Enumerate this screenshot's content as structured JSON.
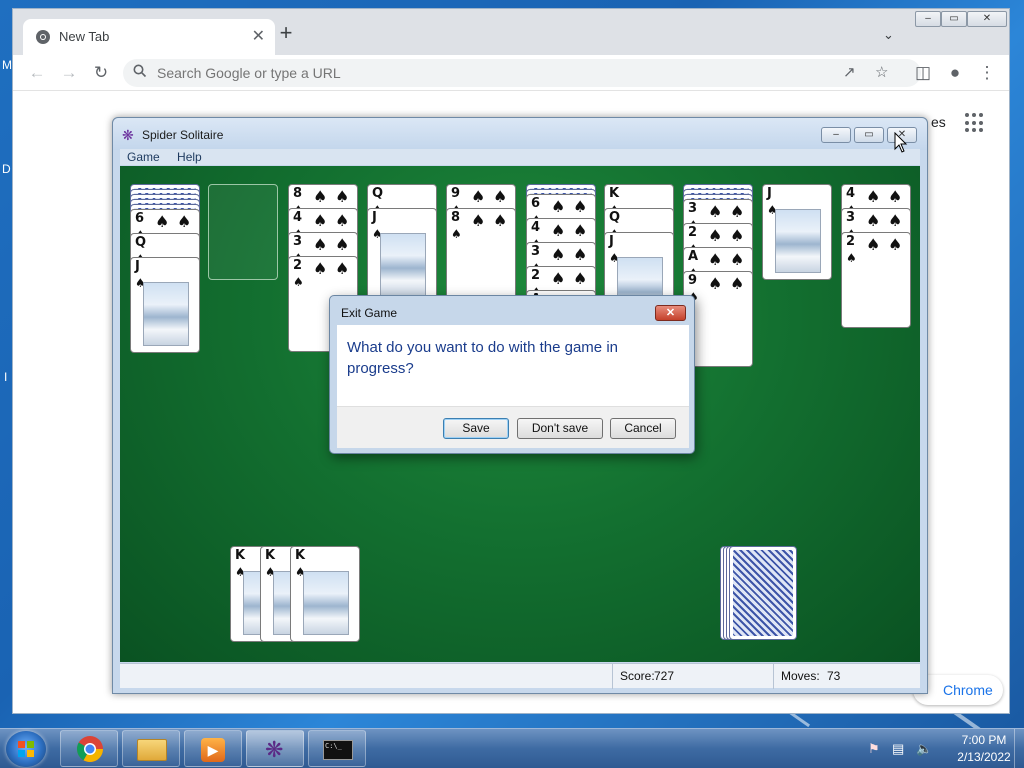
{
  "desktop": {
    "left_edge_letters": [
      "M",
      "D",
      "I"
    ]
  },
  "browser": {
    "tab_title": "New Tab",
    "tab_close": "✕",
    "new_tab": "+",
    "tab_search": "⌄",
    "omnibox_placeholder": "Search Google or type a URL",
    "ntp_shortcuts_text": "es",
    "customize_label": "Chrome",
    "window_controls": {
      "minimize": "–",
      "restore": "▭",
      "close": "✕"
    }
  },
  "spider": {
    "title": "Spider Solitaire",
    "menu": [
      "Game",
      "Help"
    ],
    "window_controls": {
      "minimize": "–",
      "restore": "▭",
      "close": "✕"
    },
    "status": {
      "score_label": "Score:",
      "score_value": "727",
      "moves_label": "Moves:",
      "moves_value": "73"
    },
    "tableau": [
      {
        "hidden": 5,
        "visible": [
          "6",
          "Q",
          "J"
        ]
      },
      {
        "hidden": 0,
        "visible": []
      },
      {
        "hidden": 0,
        "visible": [
          "8",
          "4",
          "3",
          "2"
        ]
      },
      {
        "hidden": 0,
        "visible": [
          "Q",
          "J"
        ]
      },
      {
        "hidden": 0,
        "visible": [
          "9",
          "8"
        ]
      },
      {
        "hidden": 2,
        "visible": [
          "6",
          "4",
          "3",
          "2",
          "A"
        ]
      },
      {
        "hidden": 0,
        "visible": [
          "K",
          "Q",
          "J"
        ]
      },
      {
        "hidden": 3,
        "visible": [
          "3",
          "2",
          "A",
          "9"
        ]
      },
      {
        "hidden": 0,
        "visible": [
          "J"
        ]
      },
      {
        "hidden": 0,
        "visible": [
          "4",
          "3",
          "2"
        ]
      }
    ],
    "completed_suits": [
      "K",
      "K",
      "K"
    ],
    "stock_piles": 4
  },
  "dialog": {
    "title": "Exit Game",
    "close": "✕",
    "message": "What do you want to do with the game in progress?",
    "buttons": {
      "save": "Save",
      "dont_save": "Don't save",
      "cancel": "Cancel"
    }
  },
  "taskbar": {
    "items": [
      "chrome-icon",
      "folder-icon",
      "media-player-icon",
      "spider-solitaire-icon",
      "command-prompt-icon"
    ],
    "clock_time": "7:00 PM",
    "clock_date": "2/13/2022"
  },
  "colors": {
    "felt": "#137030",
    "dialog_text": "#1a3c8c",
    "desktop": "#1f6fc0",
    "link": "#1a73e8"
  }
}
